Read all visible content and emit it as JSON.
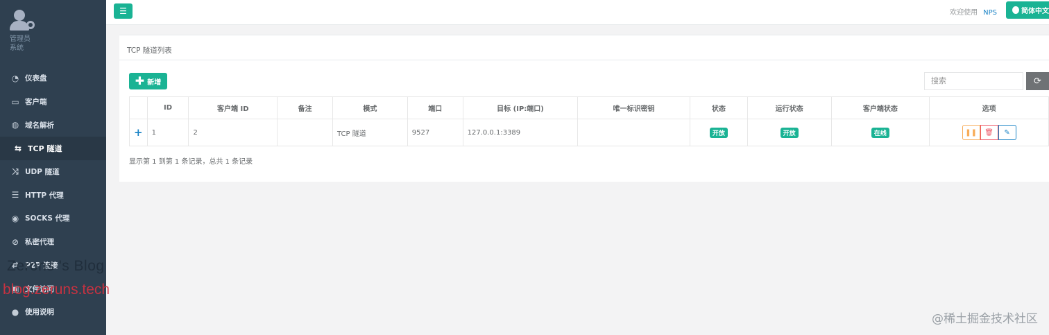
{
  "sidebar": {
    "role_line1": "管理员",
    "role_line2": "系统",
    "items": [
      {
        "label": "仪表盘",
        "icon": "dashboard-icon"
      },
      {
        "label": "客户端",
        "icon": "desktop-icon"
      },
      {
        "label": "域名解析",
        "icon": "globe-icon"
      },
      {
        "label": "TCP 隧道",
        "icon": "exchange-icon"
      },
      {
        "label": "UDP 隧道",
        "icon": "shuffle-icon"
      },
      {
        "label": "HTTP 代理",
        "icon": "server-icon"
      },
      {
        "label": "SOCKS 代理",
        "icon": "database-icon"
      },
      {
        "label": "私密代理",
        "icon": "eye-slash-icon"
      },
      {
        "label": "P2P 连接",
        "icon": "exchange-icon"
      },
      {
        "label": "文件访问",
        "icon": "briefcase-icon"
      },
      {
        "label": "使用说明",
        "icon": "lightbulb-icon"
      }
    ]
  },
  "topbar": {
    "welcome": "欢迎使用",
    "brand": "NPS",
    "lang": "简体中文"
  },
  "panel": {
    "title": "TCP 隧道列表",
    "add_label": "新增",
    "search_placeholder": "搜索",
    "columns": [
      "ID",
      "客户端 ID",
      "备注",
      "模式",
      "端口",
      "目标 (IP:端口)",
      "唯一标识密钥",
      "状态",
      "运行状态",
      "客户端状态",
      "选项"
    ],
    "row": {
      "id": "1",
      "client_id": "2",
      "remark": "",
      "mode": "TCP 隧道",
      "port": "9527",
      "target": "127.0.0.1:3389",
      "key": "",
      "status": "开放",
      "run_status": "开放",
      "client_status": "在线"
    },
    "summary": "显示第 1 到第 1 条记录，总共 1 条记录"
  },
  "watermarks": {
    "blog": "Zerons 's Blog",
    "url": "blog.zeruns.tech",
    "corner": "@稀土掘金技术社区"
  },
  "colors": {
    "sidebar": "#2f4050",
    "primary": "#1ab394",
    "link": "#1c84c6",
    "warning": "#f8ac59",
    "danger": "#ed5565"
  }
}
